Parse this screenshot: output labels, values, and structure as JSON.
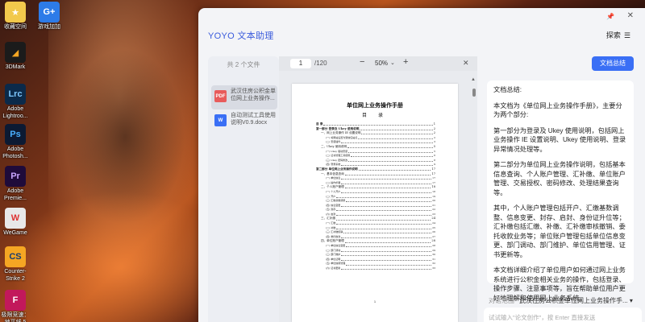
{
  "desktop": {
    "icons": [
      {
        "label": "收藏空间",
        "icon": "star-folder-icon",
        "color": "#f2c94c"
      },
      {
        "label": "游戏加加",
        "icon": "game-plus-icon",
        "color": "#2d7be8"
      },
      {
        "label": "3DMark",
        "icon": "3dmark-icon",
        "color": "#1b1b1b"
      },
      {
        "label": "Adobe Lightroo...",
        "icon": "lightroom-icon",
        "color": "#0b2a4a"
      },
      {
        "label": "Adobe Photosh...",
        "icon": "photoshop-icon",
        "color": "#0c1a33"
      },
      {
        "label": "Adobe Premie...",
        "icon": "premiere-icon",
        "color": "#1f0b3a"
      },
      {
        "label": "WeGame",
        "icon": "wegame-icon",
        "color": "#e8e8e8"
      },
      {
        "label": "Counter-Strike 2",
        "icon": "counter-strike-icon",
        "color": "#f5a623"
      },
      {
        "label": "极限竞速：地平线 5",
        "icon": "forza-icon",
        "color": "#c2185b"
      }
    ]
  },
  "app": {
    "title": "YOYO 文本助理",
    "explore_label": "探索"
  },
  "files": {
    "header": "共 2 个文件",
    "items": [
      {
        "name": "武汉住房公积金单位网上业务操作...",
        "type": "PDF",
        "color": "#e85b5b",
        "active": true
      },
      {
        "name": "自动测试工具使用说明V0.9.docx",
        "type": "W",
        "color": "#3a6ff5",
        "active": false
      }
    ]
  },
  "viewer": {
    "page": "1",
    "total": "/120",
    "zoom": "50%",
    "doc": {
      "title": "单位网上业务操作手册",
      "subtitle": "目 录",
      "toc": [
        {
          "level": 1,
          "text": "目  录",
          "page": "1"
        },
        {
          "level": 1,
          "text": "第一部分  登录及 Ukey 使用说明",
          "page": "2"
        },
        {
          "level": 2,
          "text": "一、网上业务操作 IE 设置说明",
          "page": "2"
        },
        {
          "level": 3,
          "text": "(一) 将网站设置为受信任站点",
          "page": "2"
        },
        {
          "level": 3,
          "text": "(二) 安装插件",
          "page": "3"
        },
        {
          "level": 2,
          "text": "二、Ukey 使用说明",
          "page": "5"
        },
        {
          "level": 3,
          "text": "(一) Ukey 驱动安装",
          "page": "5"
        },
        {
          "level": 3,
          "text": "(二) 证书管理工具使用",
          "page": "6"
        },
        {
          "level": 3,
          "text": "(三) Ukey 密码修改",
          "page": "8"
        },
        {
          "level": 3,
          "text": "(四) 登录系统",
          "page": "9"
        },
        {
          "level": 1,
          "text": "第二部分  单位网上业务操作说明",
          "page": "17"
        },
        {
          "level": 2,
          "text": "一、基本信息查询",
          "page": "17"
        },
        {
          "level": 3,
          "text": "(一) 单位信息",
          "page": "17"
        },
        {
          "level": 3,
          "text": "(二) 操作步骤",
          "page": "17"
        },
        {
          "level": 2,
          "text": "二、个人账户管理",
          "page": "18"
        },
        {
          "level": 3,
          "text": "(一) 个人开户",
          "page": "18"
        },
        {
          "level": 3,
          "text": "(二) 开户",
          "page": "19"
        },
        {
          "level": 3,
          "text": "(三) 汇缴基数调整",
          "page": "20"
        },
        {
          "level": 3,
          "text": "(四) 信息变更",
          "page": "21"
        },
        {
          "level": 3,
          "text": "(五) 封存",
          "page": "22"
        },
        {
          "level": 3,
          "text": "(六) 启封",
          "page": "23"
        },
        {
          "level": 2,
          "text": "三、汇补缴",
          "page": "24"
        },
        {
          "level": 3,
          "text": "(一) 汇缴",
          "page": "24"
        },
        {
          "level": 3,
          "text": "(二) 补缴",
          "page": "25"
        },
        {
          "level": 3,
          "text": "(三) 汇补缴核销",
          "page": "26"
        },
        {
          "level": 3,
          "text": "(四) 委托收款",
          "page": "27"
        },
        {
          "level": 2,
          "text": "四、单位账户管理",
          "page": "28"
        },
        {
          "level": 3,
          "text": "(一) 单位信息变更",
          "page": "28"
        },
        {
          "level": 3,
          "text": "(二) 部门调动",
          "page": "29"
        },
        {
          "level": 3,
          "text": "(三) 部门维护",
          "page": "30"
        },
        {
          "level": 3,
          "text": "(四) 单位证明",
          "page": "31"
        },
        {
          "level": 3,
          "text": "(五) 单位信用管理",
          "page": "32"
        },
        {
          "level": 3,
          "text": "(六) 证书更新",
          "page": "33"
        }
      ],
      "page_number": "1"
    }
  },
  "summary": {
    "button_label": "文档总结",
    "paragraphs": [
      "文档总结:",
      "本文档为《单位网上业务操作手册》，主要分为两个部分:",
      "第一部分为登录及 Ukey 使用说明，包括网上业务操作 IE 设置说明、Ukey 使用说明、登录异常情况处理等。",
      "第二部分为单位网上业务操作说明，包括基本信息查询、个人账户管理、汇补缴、单位账户管理、交易授权、密码修改、处理结果查询等。",
      "其中，个人账户管理包括开户、汇缴基数调整、信息变更、封存、启封、身份证升位等；汇补缴包括汇缴、补缴、汇补缴审核撤销、委托收款业务等；单位账户管理包括单位信息变更、部门调动、部门维护、单位信用管理、证书更新等。",
      "本文档详细介绍了单位用户如何通过网上业务系统进行公积金相关业务的操作，包括登录、操作步骤、注意事项等，旨在帮助单位用户更好地理解和使用网上业务系统。"
    ],
    "scope_label": "对话范围",
    "scope_value": "武汉住房公积金单位网上业务操作手...",
    "input_placeholder": "试试输入\"论文创作\"，按 Enter 直接发送"
  }
}
